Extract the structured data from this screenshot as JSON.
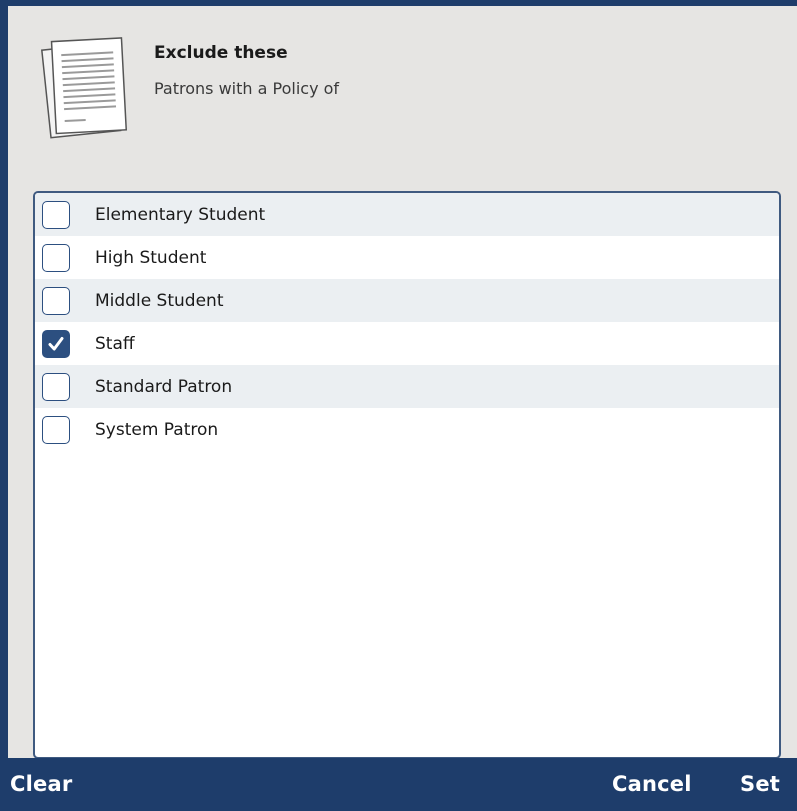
{
  "header": {
    "title": "Exclude these",
    "subtitle": "Patrons with a Policy of"
  },
  "policies": [
    {
      "label": "Elementary Student",
      "checked": false
    },
    {
      "label": "High Student",
      "checked": false
    },
    {
      "label": "Middle Student",
      "checked": false
    },
    {
      "label": "Staff",
      "checked": true
    },
    {
      "label": "Standard Patron",
      "checked": false
    },
    {
      "label": "System Patron",
      "checked": false
    }
  ],
  "footer": {
    "clear_label": "Clear",
    "cancel_label": "Cancel",
    "set_label": "Set"
  },
  "colors": {
    "frame": "#1e3d6b",
    "panel": "#e6e5e3",
    "checkbox": "#2c4f80",
    "row_alt": "#ebeff2"
  },
  "icons": {
    "header": "document-icon",
    "check": "checkmark-icon"
  }
}
